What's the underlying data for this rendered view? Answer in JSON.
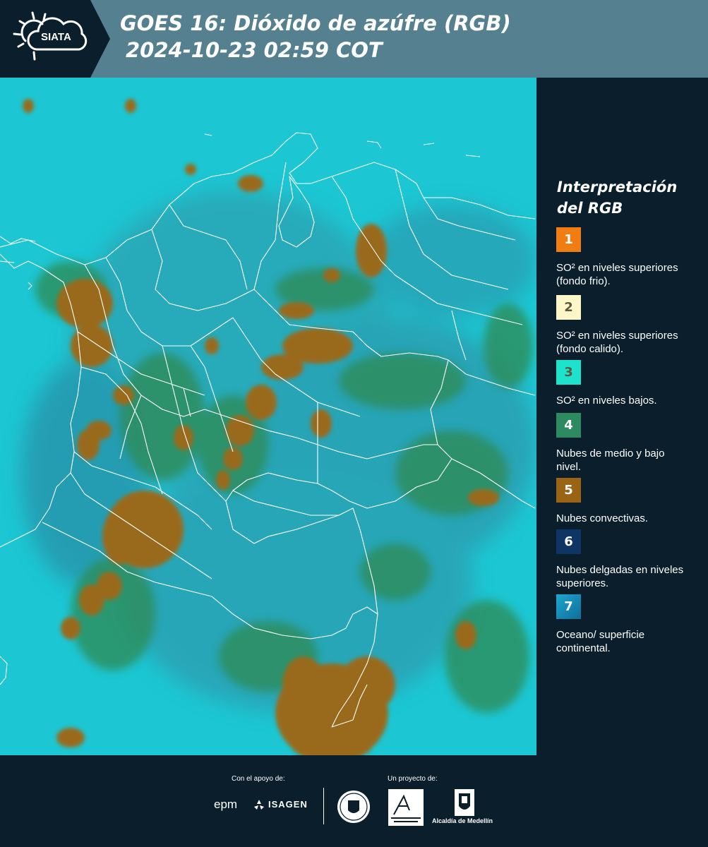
{
  "header": {
    "logo_text": "SIATA",
    "title": "GOES 16: Dióxido de azúfre (RGB)",
    "datetime": "2024-10-23 02:59 COT"
  },
  "legend": {
    "title": "Interpretación del RGB",
    "items": [
      {
        "number": "1",
        "color": "#f07d12",
        "text": "SO² en niveles superiores (fondo frio)."
      },
      {
        "number": "2",
        "color": "#fdf6c8",
        "text": "SO² en niveles superiores (fondo calido)."
      },
      {
        "number": "3",
        "color": "#1ee3cc",
        "text": "SO² en niveles bajos."
      },
      {
        "number": "4",
        "color": "#2e8a60",
        "text": "Nubes de medio y bajo nivel."
      },
      {
        "number": "5",
        "color": "#9a6414",
        "text": "Nubes convectivas."
      },
      {
        "number": "6",
        "color": "#0f3564",
        "text": "Nubes delgadas en niveles superiores."
      },
      {
        "number": "7",
        "color": "#1790bf",
        "text": "Oceano/ superficie continental."
      }
    ]
  },
  "footer": {
    "support_label": "Con el apoyo de:",
    "project_label": "Un proyecto de:",
    "sponsor_1": "epm",
    "sponsor_2": "ISAGEN",
    "alcaldia": "Alcaldía de Medellín"
  },
  "map": {
    "ocean_color": "#1bc6d2",
    "land_color": "#2aa0b6",
    "cloud_color": "#9a6a1a",
    "low_cloud_color": "#2e8a52",
    "border_color": "#ffffff"
  }
}
